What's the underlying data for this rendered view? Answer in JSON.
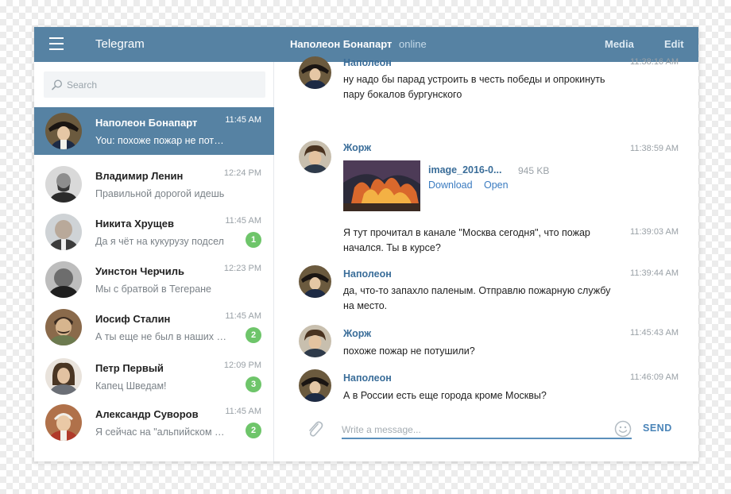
{
  "topbar": {
    "app_title": "Telegram",
    "peer_name": "Наполеон Бонапарт",
    "peer_status": "online",
    "media_label": "Media",
    "edit_label": "Edit"
  },
  "search": {
    "placeholder": "Search"
  },
  "dialogs": [
    {
      "name": "Наполеон Бонапарт",
      "time": "11:45 AM",
      "preview": "You: похоже пожар не потушили?",
      "active": true,
      "badge": ""
    },
    {
      "name": "Владимир Ленин",
      "time": "12:24 PM",
      "preview": "Правильной дорогой идешь",
      "badge": ""
    },
    {
      "name": "Никита Хрущев",
      "time": "11:45 AM",
      "preview": "Да я чёт на кукурузу подсел",
      "badge": "1"
    },
    {
      "name": "Уинстон Черчиль",
      "time": "12:23 PM",
      "preview": "Мы с братвой в Тегеране",
      "badge": ""
    },
    {
      "name": "Иосиф Сталин",
      "time": "11:45 AM",
      "preview": "А ты еще не был в наших лагерях?",
      "badge": "2"
    },
    {
      "name": "Петр Первый",
      "time": "12:09 PM",
      "preview": "Капец Шведам!",
      "badge": "3"
    },
    {
      "name": "Александр Суворов",
      "time": "11:45 AM",
      "preview": "Я сейчас на \"альпийском курорте\"",
      "badge": "2"
    }
  ],
  "messages": [
    {
      "author": "Наполеон",
      "time": "11:38:16 AM",
      "text": "ну надо бы парад устроить в честь победы и опрокинуть пару бокалов бургунского"
    },
    {
      "author": "Жорж",
      "time": "11:38:59 AM",
      "file_name": "image_2016-0...",
      "file_size": "945 KB",
      "download": "Download",
      "open": "Open"
    },
    {
      "time": "11:39:03 AM",
      "text": "Я тут прочитал в канале \"Москва сегодня\", что пожар начался. Ты в курсе?"
    },
    {
      "author": "Наполеон",
      "time": "11:39:44 AM",
      "text": "да, что-то запахло паленым. Отправлю пожарную службу на место."
    },
    {
      "author": "Жорж",
      "time": "11:45:43 AM",
      "text": "похоже пожар не потушили?"
    },
    {
      "author": "Наполеон",
      "time": "11:46:09 AM",
      "text": "А в России есть еще города кроме Москвы?"
    }
  ],
  "composer": {
    "placeholder": "Write a message...",
    "send_label": "SEND"
  },
  "colors": {
    "header": "#5682a3",
    "active_dialog": "#5682a3",
    "author": "#3a6d99",
    "badge": "#6ec56a",
    "link": "#3a7bc0"
  }
}
